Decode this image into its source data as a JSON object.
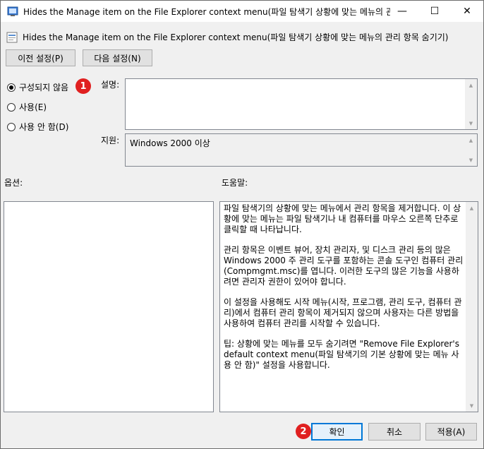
{
  "window": {
    "title": "Hides the Manage item on the File Explorer context menu(파일 탐색기 상황에 맞는 메뉴의 관...",
    "minimize_glyph": "—",
    "maximize_glyph": "☐",
    "close_glyph": "✕"
  },
  "header": {
    "policy_title": "Hides the Manage item on the File Explorer context menu(파일 탐색기 상황에 맞는 메뉴의 관리 항목 숨기기)"
  },
  "nav": {
    "prev_label": "이전 설정(P)",
    "next_label": "다음 설정(N)"
  },
  "state": {
    "options": [
      {
        "label": "구성되지 않음",
        "selected": true
      },
      {
        "label": "사용(E)",
        "selected": false
      },
      {
        "label": "사용 안 함(D)",
        "selected": false
      }
    ]
  },
  "fields": {
    "comment_label": "설명:",
    "comment_value": "",
    "support_label": "지원:",
    "support_value": "Windows 2000 이상"
  },
  "sections": {
    "options_label": "옵션:",
    "help_label": "도움말:"
  },
  "help": {
    "paragraphs": [
      "파일 탐색기의 상황에 맞는 메뉴에서 관리 항목을 제거합니다. 이 상황에 맞는 메뉴는 파일 탐색기나 내 컴퓨터를 마우스 오른쪽 단추로 클릭할 때 나타납니다.",
      "관리 항목은 이벤트 뷰어, 장치 관리자, 및 디스크 관리 등의 많은 Windows 2000 주 관리 도구를 포함하는 콘솔 도구인 컴퓨터 관리(Compmgmt.msc)를 엽니다. 이러한 도구의 많은 기능을 사용하려면 관리자 권한이 있어야 합니다.",
      "이 설정을 사용해도 시작 메뉴(시작, 프로그램, 관리 도구, 컴퓨터 관리)에서 컴퓨터 관리 항목이 제거되지 않으며 사용자는 다른 방법을 사용하여 컴퓨터 관리를 시작할 수 있습니다.",
      "팁: 상황에 맞는 메뉴를 모두 숨기려면 \"Remove File Explorer's default context menu(파일 탐색기의 기본 상황에 맞는 메뉴 사용 안 함)\" 설정을 사용합니다."
    ]
  },
  "footer": {
    "ok_label": "확인",
    "cancel_label": "취소",
    "apply_label": "적용(A)"
  },
  "badges": {
    "badge1": "1",
    "badge2": "2"
  },
  "colors": {
    "accent": "#0078d7",
    "badge": "#e02020"
  }
}
